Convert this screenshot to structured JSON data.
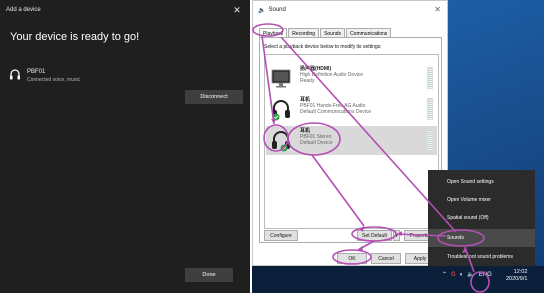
{
  "add_device": {
    "window_title": "Add a device",
    "headline": "Your device is ready to go!",
    "device_name": "PBF01",
    "device_status": "Connected voice, music",
    "disconnect_label": "Disconnect",
    "done_label": "Done"
  },
  "sound": {
    "window_title": "Sound",
    "tabs": [
      {
        "label": "Playback",
        "active": true
      },
      {
        "label": "Recording",
        "active": false
      },
      {
        "label": "Sounds",
        "active": false
      },
      {
        "label": "Communications",
        "active": false
      }
    ],
    "instruction": "Select a playback device below to modify its settings:",
    "devices": [
      {
        "name": "扬声器(HDMI)",
        "line1": "High Definition Audio Device",
        "line2": "Ready",
        "selected": false
      },
      {
        "name": "耳机",
        "line1": "PBF01 Hands-Free AG Audio",
        "line2": "Default Communications Device",
        "selected": false
      },
      {
        "name": "耳机",
        "line1": "PBF01 Stereo",
        "line2": "Default Device",
        "selected": true
      }
    ],
    "buttons": {
      "configure": "Configure",
      "set_default": "Set Default",
      "properties": "Properties",
      "ok": "OK",
      "cancel": "Cancel",
      "apply": "Apply"
    }
  },
  "context_menu": {
    "items": [
      {
        "label": "Open Sound settings"
      },
      {
        "label": "Open Volume mixer"
      },
      {
        "label": "Spatial sound (Off)"
      },
      {
        "label": "Sounds",
        "highlighted": true
      },
      {
        "label": "Troubleshoot sound problems"
      }
    ]
  },
  "taskbar": {
    "language": "ENG",
    "time": "12:02",
    "date": "2020/9/1"
  },
  "colors": {
    "annotation": "#b44fb4",
    "dark_panel": "#1f1f1f",
    "menu_bg": "#2b2b2b"
  }
}
